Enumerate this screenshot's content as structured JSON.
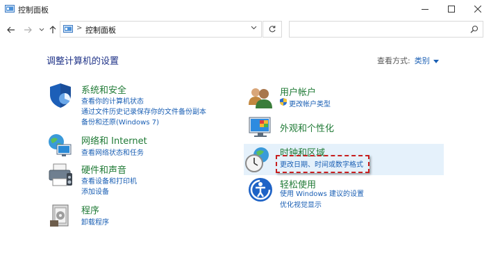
{
  "window": {
    "title": "控制面板",
    "icon": "control-panel-icon"
  },
  "address": {
    "separator": ">",
    "breadcrumb": "控制面板"
  },
  "search": {
    "placeholder": ""
  },
  "header": {
    "title": "调整计算机的设置",
    "view_by_label": "查看方式:",
    "view_by_value": "类别"
  },
  "categories": [
    {
      "heading": "系统和安全",
      "icon": "shield-icon",
      "links": [
        "查看你的计算机状态",
        "通过文件历史记录保存你的文件备份副本",
        "备份和还原(Windows 7)"
      ]
    },
    {
      "heading": "网络和 Internet",
      "icon": "network-globe-icon",
      "links": [
        "查看网络状态和任务"
      ]
    },
    {
      "heading": "硬件和声音",
      "icon": "printer-icon",
      "links": [
        "查看设备和打印机",
        "添加设备"
      ]
    },
    {
      "heading": "程序",
      "icon": "programs-icon",
      "links": [
        "卸载程序"
      ]
    },
    {
      "heading": "用户帐户",
      "icon": "users-icon",
      "links": [
        "更改帐户类型"
      ]
    },
    {
      "heading": "外观和个性化",
      "icon": "monitor-icon",
      "links": []
    },
    {
      "heading": "时钟和区域",
      "icon": "clock-globe-icon",
      "links": [
        "更改日期、时间或数字格式"
      ]
    },
    {
      "heading": "轻松使用",
      "icon": "accessibility-icon",
      "links": [
        "使用 Windows 建议的设置",
        "优化视觉显示"
      ]
    }
  ],
  "colors": {
    "heading_green": "#1f7a35",
    "link_blue": "#1a5fb4",
    "title_blue": "#1e3287",
    "highlight": "#e5f1fb",
    "annotation_red": "#c81e1e"
  }
}
